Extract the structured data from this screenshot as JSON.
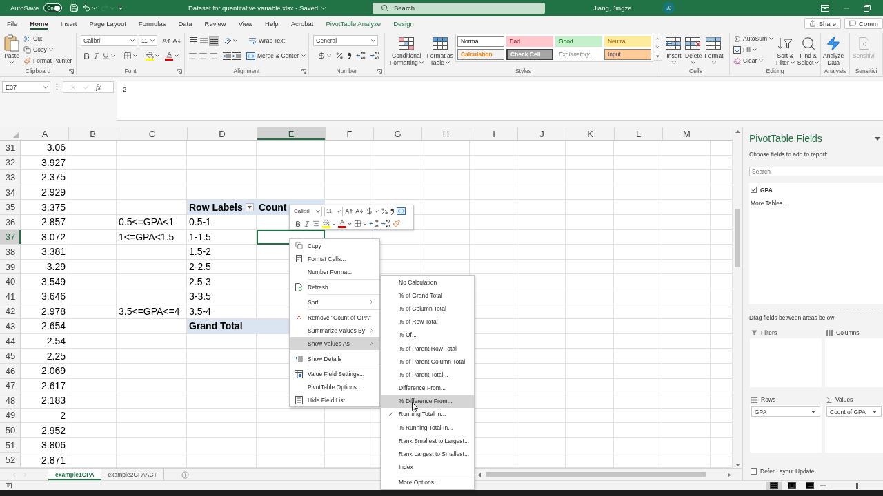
{
  "title_bar": {
    "autosave": {
      "label": "AutoSave",
      "state": "On",
      "on": true
    },
    "quick_access": [
      {
        "kind": "save",
        "disabled": false
      },
      {
        "kind": "undo",
        "disabled": false
      },
      {
        "kind": "redo",
        "disabled": true
      }
    ],
    "title": "Dataset for quantitative variable.xlsx  -  Saved",
    "search": {
      "placeholder": "Search"
    },
    "user": {
      "name": "Jiang, Jingze",
      "initials": "JJ"
    }
  },
  "ribbon_tabs": [
    {
      "label": "File",
      "selected": false,
      "kind": "standard"
    },
    {
      "label": "Home",
      "selected": true,
      "kind": "standard"
    },
    {
      "label": "Insert",
      "selected": false,
      "kind": "standard"
    },
    {
      "label": "Page Layout",
      "selected": false,
      "kind": "standard"
    },
    {
      "label": "Formulas",
      "selected": false,
      "kind": "standard"
    },
    {
      "label": "Data",
      "selected": false,
      "kind": "standard"
    },
    {
      "label": "Review",
      "selected": false,
      "kind": "standard"
    },
    {
      "label": "View",
      "selected": false,
      "kind": "standard"
    },
    {
      "label": "Help",
      "selected": false,
      "kind": "standard"
    },
    {
      "label": "Acrobat",
      "selected": false,
      "kind": "standard"
    },
    {
      "label": "PivotTable Analyze",
      "selected": false,
      "kind": "contextual"
    },
    {
      "label": "Design",
      "selected": false,
      "kind": "contextual"
    }
  ],
  "ribbon_actions": {
    "share": "Share",
    "comments": "Comm"
  },
  "ribbon": {
    "clipboard": {
      "label": "Clipboard",
      "paste": "Paste",
      "cut": "Cut",
      "copy": "Copy",
      "format_painter": "Format Painter"
    },
    "font": {
      "label": "Font",
      "name": "Calibri",
      "size": "11"
    },
    "alignment": {
      "label": "Alignment",
      "vertical_align": [
        {
          "kind": "top",
          "selected": false
        },
        {
          "kind": "middle",
          "selected": false
        },
        {
          "kind": "bottom",
          "selected": true
        }
      ],
      "wrap_text": "Wrap Text",
      "merge_center": "Merge & Center"
    },
    "number": {
      "label": "Number",
      "format": "General"
    },
    "styles": {
      "label": "Styles",
      "conditional_formatting": [
        "Conditional",
        "Formatting"
      ],
      "format_as_table": [
        "Format as",
        "Table"
      ],
      "cell_styles": [
        {
          "label": "Normal",
          "kind": "normal"
        },
        {
          "label": "Bad",
          "kind": "bad"
        },
        {
          "label": "Good",
          "kind": "good"
        },
        {
          "label": "Neutral",
          "kind": "neutral"
        },
        {
          "label": "Calculation",
          "kind": "calculation"
        },
        {
          "label": "Check Cell",
          "kind": "check"
        },
        {
          "label": "Explanatory ...",
          "kind": "explanatory"
        },
        {
          "label": "Input",
          "kind": "input"
        }
      ]
    },
    "cells": {
      "label": "Cells",
      "buttons": [
        {
          "label": "Insert",
          "kind": "insert"
        },
        {
          "label": "Delete",
          "kind": "delete"
        },
        {
          "label": "Format",
          "kind": "format"
        }
      ]
    },
    "editing": {
      "label": "Editing",
      "autosum": "AutoSum",
      "fill": "Fill",
      "clear": "Clear",
      "sort_filter": [
        "Sort &",
        "Filter"
      ],
      "find_select": [
        "Find &",
        "Select"
      ]
    },
    "analysis": {
      "label": "Analysis",
      "analyze_data": [
        "Analyze",
        "Data"
      ]
    },
    "sensitivity": {
      "label": "Sensitivi",
      "button": "Sensitivi",
      "disabled": true
    }
  },
  "formula_bar": {
    "name_box": "E37",
    "insert_function": "fx",
    "formula": "2"
  },
  "sheet": {
    "columns": [
      {
        "label": "A",
        "selected": false
      },
      {
        "label": "B",
        "selected": false
      },
      {
        "label": "C",
        "selected": false
      },
      {
        "label": "D",
        "selected": false
      },
      {
        "label": "E",
        "selected": true
      },
      {
        "label": "F",
        "selected": false
      },
      {
        "label": "G",
        "selected": false
      },
      {
        "label": "H",
        "selected": false
      },
      {
        "label": "I",
        "selected": false
      },
      {
        "label": "J",
        "selected": false
      },
      {
        "label": "K",
        "selected": false
      },
      {
        "label": "L",
        "selected": false
      },
      {
        "label": "M",
        "selected": false
      }
    ],
    "rows": [
      {
        "number": "31",
        "selected": false,
        "a": "3.06"
      },
      {
        "number": "32",
        "selected": false,
        "a": "3.927"
      },
      {
        "number": "33",
        "selected": false,
        "a": "2.375"
      },
      {
        "number": "34",
        "selected": false,
        "a": "2.929"
      },
      {
        "number": "35",
        "selected": false,
        "a": "3.375",
        "d": "Row Labels",
        "e": "Count",
        "kind": "pivot_header"
      },
      {
        "number": "36",
        "selected": false,
        "a": "2.857",
        "c": "0.5<=GPA<1",
        "d": "0.5-1"
      },
      {
        "number": "37",
        "selected": true,
        "a": "3.072",
        "c": "1<=GPA<1.5",
        "d": "1-1.5"
      },
      {
        "number": "38",
        "selected": false,
        "a": "3.381",
        "d": "1.5-2"
      },
      {
        "number": "39",
        "selected": false,
        "a": "3.29",
        "d": "2-2.5"
      },
      {
        "number": "40",
        "selected": false,
        "a": "3.549",
        "d": "2.5-3"
      },
      {
        "number": "41",
        "selected": false,
        "a": "3.646",
        "d": "3-3.5"
      },
      {
        "number": "42",
        "selected": false,
        "a": "2.978",
        "c": "3.5<=GPA<=4",
        "d": "3.5-4"
      },
      {
        "number": "43",
        "selected": false,
        "a": "2.654",
        "d": "Grand Total",
        "kind": "pivot_total"
      },
      {
        "number": "44",
        "selected": false,
        "a": "2.54"
      },
      {
        "number": "45",
        "selected": false,
        "a": "2.25"
      },
      {
        "number": "46",
        "selected": false,
        "a": "2.069"
      },
      {
        "number": "47",
        "selected": false,
        "a": "2.617"
      },
      {
        "number": "48",
        "selected": false,
        "a": "2.183"
      },
      {
        "number": "49",
        "selected": false,
        "a": "2"
      },
      {
        "number": "50",
        "selected": false,
        "a": "2.952"
      },
      {
        "number": "51",
        "selected": false,
        "a": "3.806"
      },
      {
        "number": "52",
        "selected": false,
        "a": "2.871"
      }
    ]
  },
  "mini_toolbar": {
    "font": "Calibri",
    "size": "11"
  },
  "context_menu": [
    {
      "label": "Copy",
      "kind": "copy",
      "selected": false,
      "submenu": false,
      "divider_below": false
    },
    {
      "label": "Format Cells...",
      "kind": "format_cells",
      "selected": false,
      "submenu": false,
      "divider_below": false
    },
    {
      "label": "Number Format...",
      "kind": "plain",
      "selected": false,
      "submenu": false,
      "divider_below": true
    },
    {
      "label": "Refresh",
      "kind": "refresh",
      "selected": false,
      "submenu": false,
      "divider_below": true
    },
    {
      "label": "Sort",
      "kind": "plain",
      "selected": false,
      "submenu": true,
      "divider_below": true
    },
    {
      "label": "Remove \"Count of GPA\"",
      "kind": "remove",
      "selected": false,
      "submenu": false,
      "divider_below": false
    },
    {
      "label": "Summarize Values By",
      "kind": "plain",
      "selected": false,
      "submenu": true,
      "divider_below": false
    },
    {
      "label": "Show Values As",
      "kind": "plain",
      "selected": true,
      "submenu": true,
      "divider_below": true
    },
    {
      "label": "Show Details",
      "kind": "details",
      "selected": false,
      "submenu": false,
      "divider_below": true
    },
    {
      "label": "Value Field Settings...",
      "kind": "field_settings",
      "selected": false,
      "submenu": false,
      "divider_below": false
    },
    {
      "label": "PivotTable Options...",
      "kind": "plain",
      "selected": false,
      "submenu": false,
      "divider_below": false
    },
    {
      "label": "Hide Field List",
      "kind": "field_list",
      "selected": false,
      "submenu": false,
      "divider_below": false
    }
  ],
  "submenu": [
    {
      "label": "No Calculation",
      "selected": false,
      "checked": false,
      "divider_below": false
    },
    {
      "label": "% of Grand Total",
      "selected": false,
      "checked": false,
      "divider_below": false
    },
    {
      "label": "% of Column Total",
      "selected": false,
      "checked": false,
      "divider_below": false
    },
    {
      "label": "% of Row Total",
      "selected": false,
      "checked": false,
      "divider_below": false
    },
    {
      "label": "% Of...",
      "selected": false,
      "checked": false,
      "divider_below": false
    },
    {
      "label": "% of Parent Row Total",
      "selected": false,
      "checked": false,
      "divider_below": false
    },
    {
      "label": "% of Parent Column Total",
      "selected": false,
      "checked": false,
      "divider_below": false
    },
    {
      "label": "% of Parent Total...",
      "selected": false,
      "checked": false,
      "divider_below": false
    },
    {
      "label": "Difference From...",
      "selected": false,
      "checked": false,
      "divider_below": false
    },
    {
      "label": "% Difference From...",
      "selected": true,
      "checked": false,
      "divider_below": false
    },
    {
      "label": "Running Total In...",
      "selected": false,
      "checked": true,
      "divider_below": false
    },
    {
      "label": "% Running Total In...",
      "selected": false,
      "checked": false,
      "divider_below": false
    },
    {
      "label": "Rank Smallest to Largest...",
      "selected": false,
      "checked": false,
      "divider_below": false
    },
    {
      "label": "Rank Largest to Smallest...",
      "selected": false,
      "checked": false,
      "divider_below": false
    },
    {
      "label": "Index",
      "selected": false,
      "checked": false,
      "divider_below": true
    },
    {
      "label": "More Options...",
      "selected": false,
      "checked": false,
      "divider_below": false
    }
  ],
  "pivot_fields": {
    "title": "PivotTable Fields",
    "subtitle": "Choose fields to add to report:",
    "search": {
      "placeholder": "Search"
    },
    "fields": [
      {
        "label": "GPA",
        "checked": true
      }
    ],
    "more_tables": "More Tables...",
    "areas_hint": "Drag fields between areas below:",
    "areas": [
      {
        "label": "Filters",
        "kind": "filters"
      },
      {
        "label": "Columns",
        "kind": "columns"
      },
      {
        "label": "Rows",
        "kind": "rows",
        "items": [
          "GPA"
        ]
      },
      {
        "label": "Values",
        "kind": "values",
        "items": [
          "Count of GPA"
        ]
      }
    ],
    "defer": {
      "label": "Defer Layout Update",
      "checked": false
    }
  },
  "sheet_tabs": [
    {
      "label": "example1GPA",
      "selected": true
    },
    {
      "label": "example2GPAACT",
      "selected": false
    }
  ],
  "status_bar": {
    "views": [
      {
        "kind": "normal",
        "selected": true
      },
      {
        "kind": "page_layout",
        "selected": false
      },
      {
        "kind": "page_break",
        "selected": false
      }
    ],
    "zoom": {
      "level": 0.5
    }
  }
}
